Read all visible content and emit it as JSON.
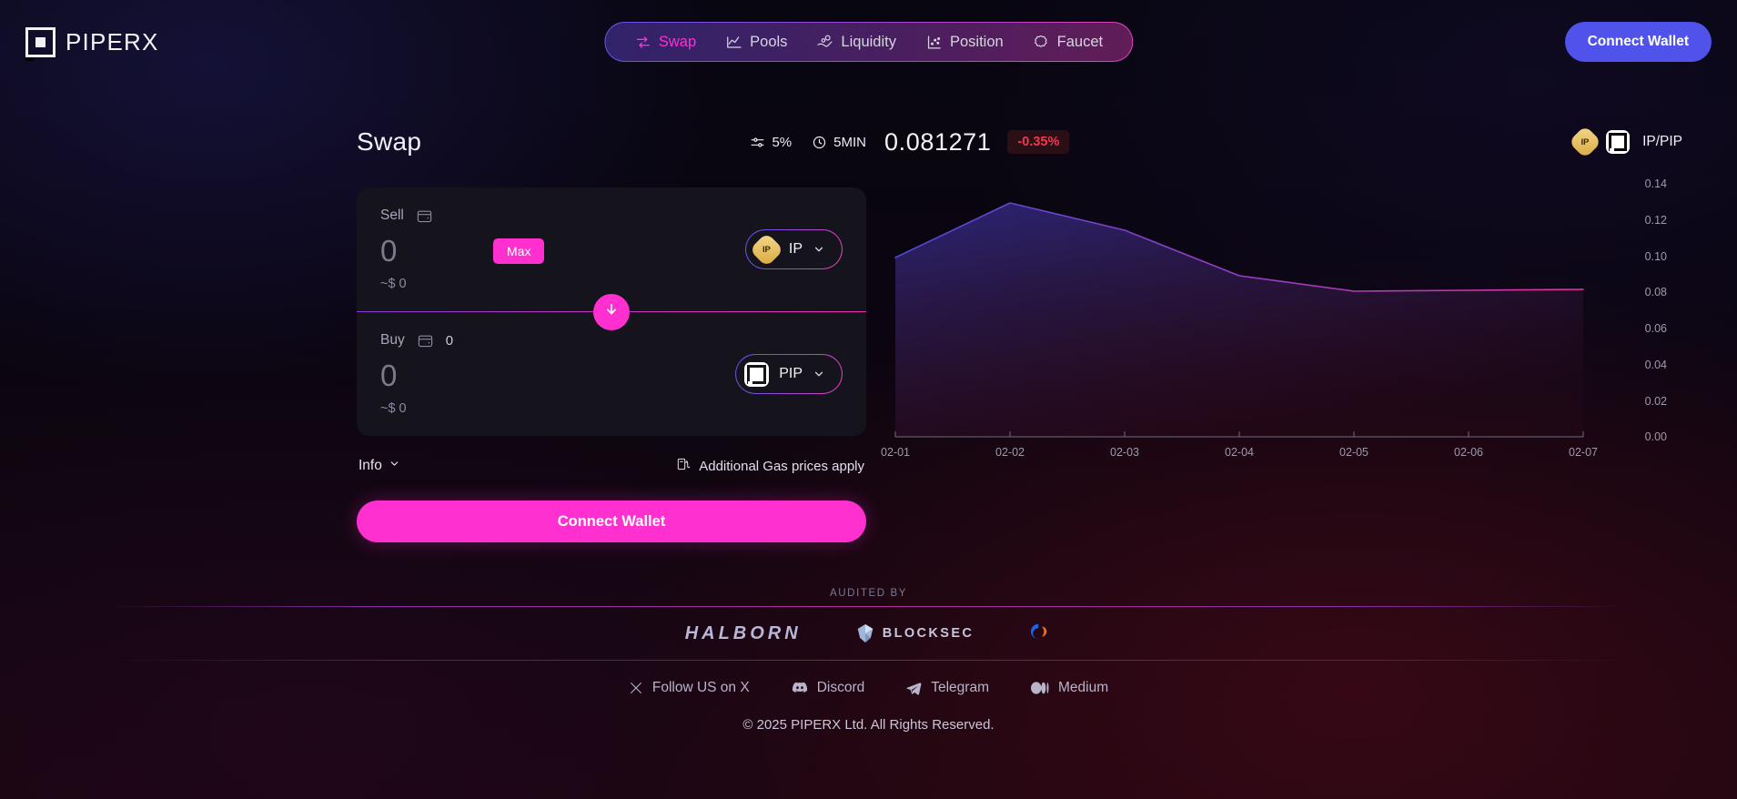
{
  "brand": {
    "name": "PIPERX",
    "icon": "piperx-logo-icon"
  },
  "nav": {
    "items": [
      {
        "label": "Swap",
        "icon": "swap-arrows-icon",
        "active": true
      },
      {
        "label": "Pools",
        "icon": "line-chart-icon",
        "active": false
      },
      {
        "label": "Liquidity",
        "icon": "hand-coin-icon",
        "active": false
      },
      {
        "label": "Position",
        "icon": "scatter-plot-icon",
        "active": false
      },
      {
        "label": "Faucet",
        "icon": "gear-blob-icon",
        "active": false
      }
    ]
  },
  "header": {
    "connect_wallet_label": "Connect Wallet"
  },
  "swap": {
    "title": "Swap",
    "slippage": {
      "value": "5%",
      "icon": "sliders-icon"
    },
    "deadline": {
      "value": "5MIN",
      "icon": "clock-icon"
    },
    "sell": {
      "label": "Sell",
      "wallet_icon": "wallet-icon",
      "balance": "",
      "amount": "0",
      "amount_placeholder": "0",
      "max_label": "Max",
      "usd_value": "~$ 0",
      "token": {
        "symbol": "IP",
        "icon": "ip-token-icon",
        "badge": "IP"
      }
    },
    "buy": {
      "label": "Buy",
      "wallet_icon": "wallet-icon",
      "balance": "0",
      "amount": "0",
      "amount_placeholder": "0",
      "usd_value": "~$ 0",
      "token": {
        "symbol": "PIP",
        "icon": "pip-token-icon"
      }
    },
    "switch_icon": "swap-direction-arrow-icon",
    "info_label": "Info",
    "info_chevron": "chevron-down-icon",
    "gas_note": "Additional Gas prices apply",
    "gas_icon": "gas-pump-icon",
    "connect_wallet_label": "Connect Wallet"
  },
  "market": {
    "price": "0.081271",
    "change": "-0.35%",
    "change_color": "#f0384f",
    "pair": "IP/PIP",
    "pair_icons": [
      "ip-token-icon",
      "pip-token-icon"
    ]
  },
  "chart_data": {
    "type": "area",
    "title": "",
    "xlabel": "",
    "ylabel": "",
    "x": [
      "02-01",
      "02-02",
      "02-03",
      "02-04",
      "02-05",
      "02-06",
      "02-07"
    ],
    "categories": [
      "02-01",
      "02-02",
      "02-03",
      "02-04",
      "02-05",
      "02-06",
      "02-07"
    ],
    "values": [
      0.099,
      0.13,
      0.116,
      0.089,
      0.081,
      0.0812,
      0.0813
    ],
    "series": [
      {
        "name": "IP/PIP",
        "values": [
          0.099,
          0.13,
          0.116,
          0.089,
          0.081,
          0.0812,
          0.0813
        ]
      }
    ],
    "ylim": [
      0.0,
      0.14
    ],
    "yticks": [
      "0.14",
      "0.12",
      "0.10",
      "0.08",
      "0.06",
      "0.04",
      "0.02",
      "0.00"
    ],
    "ytick_values": [
      0.14,
      0.12,
      0.1,
      0.08,
      0.06,
      0.04,
      0.02,
      0.0
    ],
    "grid": false,
    "legend": "none",
    "line_color_start": "#4d49d4",
    "line_color_end": "#e8339f",
    "fill_opacity": 0.32
  },
  "footer": {
    "audited_by_label": "AUDITED BY",
    "auditors": [
      {
        "name": "HALBORN",
        "icon": "halborn-logo-icon"
      },
      {
        "name": "BLOCKSEC",
        "icon": "blocksec-logo-icon"
      },
      {
        "name": "",
        "icon": "certik-logo-icon"
      }
    ],
    "socials": [
      {
        "label": "Follow US on X",
        "icon": "x-twitter-icon"
      },
      {
        "label": "Discord",
        "icon": "discord-icon"
      },
      {
        "label": "Telegram",
        "icon": "telegram-icon"
      },
      {
        "label": "Medium",
        "icon": "medium-icon"
      }
    ],
    "copyright": "© 2025 PIPERX Ltd. All Rights Reserved."
  }
}
